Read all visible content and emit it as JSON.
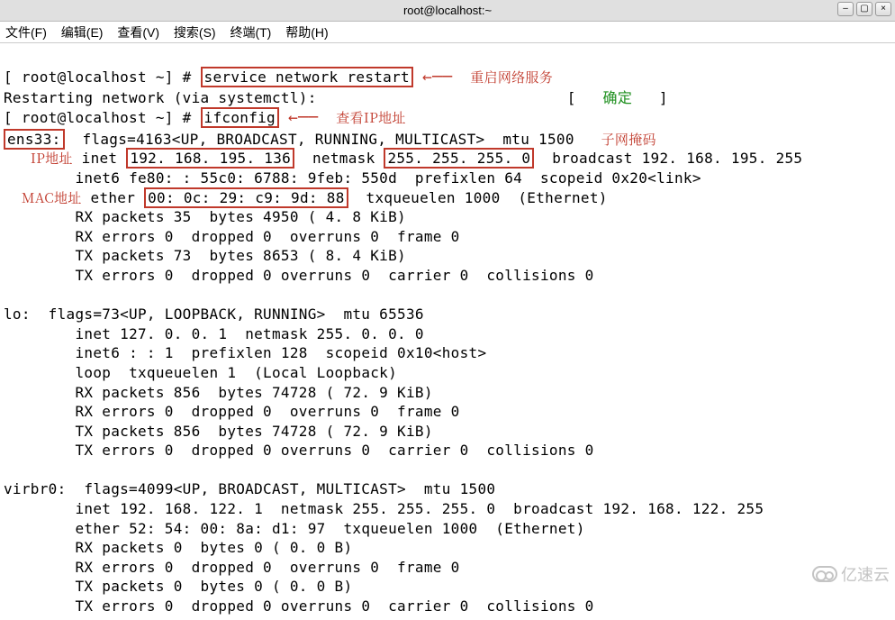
{
  "window": {
    "title": "root@localhost:~"
  },
  "menubar": {
    "file": "文件(F)",
    "edit": "编辑(E)",
    "view": "查看(V)",
    "search": "搜索(S)",
    "terminal": "终端(T)",
    "help": "帮助(H)"
  },
  "prompt": "[ root@localhost ~] #",
  "cmds": {
    "restart": "service network restart",
    "ifconfig": "ifconfig"
  },
  "restart_msg": "Restarting network (via systemctl):",
  "ok_text": "确定",
  "annotations": {
    "restart": "重启网络服务",
    "check_ip": "查看IP地址",
    "subnet": "子网掩码",
    "ip": "IP地址",
    "mac": "MAC地址"
  },
  "ens33": {
    "iface": "ens33:",
    "flags": "flags=4163<UP, BROADCAST, RUNNING, MULTICAST>  mtu 1500",
    "ip": "192. 168. 195. 136",
    "netmask": "255. 255. 255. 0",
    "broadcast": "broadcast 192. 168. 195. 255",
    "inet6": "inet6 fe80: : 55c0: 6788: 9feb: 550d  prefixlen 64  scopeid 0x20<link>",
    "mac": "00: 0c: 29: c9: 9d: 88",
    "ether_tail": "txqueuelen 1000  (Ethernet)",
    "rx_p": "RX packets 35  bytes 4950 ( 4. 8 KiB)",
    "rx_e": "RX errors 0  dropped 0  overruns 0  frame 0",
    "tx_p": "TX packets 73  bytes 8653 ( 8. 4 KiB)",
    "tx_e": "TX errors 0  dropped 0 overruns 0  carrier 0  collisions 0"
  },
  "lo": {
    "head": "lo:  flags=73<UP, LOOPBACK, RUNNING>  mtu 65536",
    "inet": "inet 127. 0. 0. 1  netmask 255. 0. 0. 0",
    "inet6": "inet6 : : 1  prefixlen 128  scopeid 0x10<host>",
    "loop": "loop  txqueuelen 1  (Local Loopback)",
    "rx_p": "RX packets 856  bytes 74728 ( 72. 9 KiB)",
    "rx_e": "RX errors 0  dropped 0  overruns 0  frame 0",
    "tx_p": "TX packets 856  bytes 74728 ( 72. 9 KiB)",
    "tx_e": "TX errors 0  dropped 0 overruns 0  carrier 0  collisions 0"
  },
  "virbr0": {
    "head": "virbr0:  flags=4099<UP, BROADCAST, MULTICAST>  mtu 1500",
    "inet": "inet 192. 168. 122. 1  netmask 255. 255. 255. 0  broadcast 192. 168. 122. 255",
    "ether": "ether 52: 54: 00: 8a: d1: 97  txqueuelen 1000  (Ethernet)",
    "rx_p": "RX packets 0  bytes 0 ( 0. 0 B)",
    "rx_e": "RX errors 0  dropped 0  overruns 0  frame 0",
    "tx_p": "TX packets 0  bytes 0 ( 0. 0 B)",
    "tx_e": "TX errors 0  dropped 0 overruns 0  carrier 0  collisions 0"
  },
  "watermark": "亿速云"
}
